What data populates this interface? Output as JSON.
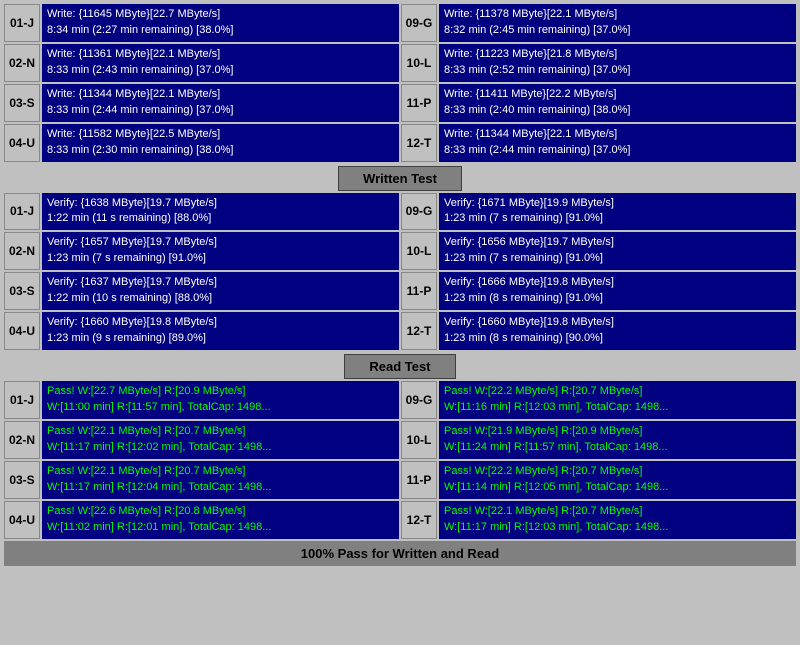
{
  "sections": {
    "write": {
      "label": "Written Test",
      "rows": [
        {
          "left": {
            "id": "01-J",
            "l1": "Write: {11645 MByte}[22.7 MByte/s]",
            "l2": "8:34 min (2:27 min remaining)  [38.0%]"
          },
          "right": {
            "id": "09-G",
            "l1": "Write: {11378 MByte}[22.1 MByte/s]",
            "l2": "8:32 min (2:45 min remaining)  [37.0%]"
          }
        },
        {
          "left": {
            "id": "02-N",
            "l1": "Write: {11361 MByte}[22.1 MByte/s]",
            "l2": "8:33 min (2:43 min remaining)  [37.0%]"
          },
          "right": {
            "id": "10-L",
            "l1": "Write: {11223 MByte}[21.8 MByte/s]",
            "l2": "8:33 min (2:52 min remaining)  [37.0%]"
          }
        },
        {
          "left": {
            "id": "03-S",
            "l1": "Write: {11344 MByte}[22.1 MByte/s]",
            "l2": "8:33 min (2:44 min remaining)  [37.0%]"
          },
          "right": {
            "id": "11-P",
            "l1": "Write: {11411 MByte}[22.2 MByte/s]",
            "l2": "8:33 min (2:40 min remaining)  [38.0%]"
          }
        },
        {
          "left": {
            "id": "04-U",
            "l1": "Write: {11582 MByte}[22.5 MByte/s]",
            "l2": "8:33 min (2:30 min remaining)  [38.0%]"
          },
          "right": {
            "id": "12-T",
            "l1": "Write: {11344 MByte}[22.1 MByte/s]",
            "l2": "8:33 min (2:44 min remaining)  [37.0%]"
          }
        }
      ]
    },
    "verify": {
      "label": "Written Test",
      "rows": [
        {
          "left": {
            "id": "01-J",
            "l1": "Verify: {1638 MByte}[19.7 MByte/s]",
            "l2": "1:22 min (11 s remaining)   [88.0%]"
          },
          "right": {
            "id": "09-G",
            "l1": "Verify: {1671 MByte}[19.9 MByte/s]",
            "l2": "1:23 min (7 s remaining)   [91.0%]"
          }
        },
        {
          "left": {
            "id": "02-N",
            "l1": "Verify: {1657 MByte}[19.7 MByte/s]",
            "l2": "1:23 min (7 s remaining)   [91.0%]"
          },
          "right": {
            "id": "10-L",
            "l1": "Verify: {1656 MByte}[19.7 MByte/s]",
            "l2": "1:23 min (7 s remaining)   [91.0%]"
          }
        },
        {
          "left": {
            "id": "03-S",
            "l1": "Verify: {1637 MByte}[19.7 MByte/s]",
            "l2": "1:22 min (10 s remaining)   [88.0%]"
          },
          "right": {
            "id": "11-P",
            "l1": "Verify: {1666 MByte}[19.8 MByte/s]",
            "l2": "1:23 min (8 s remaining)   [91.0%]"
          }
        },
        {
          "left": {
            "id": "04-U",
            "l1": "Verify: {1660 MByte}[19.8 MByte/s]",
            "l2": "1:23 min (9 s remaining)   [89.0%]"
          },
          "right": {
            "id": "12-T",
            "l1": "Verify: {1660 MByte}[19.8 MByte/s]",
            "l2": "1:23 min (8 s remaining)   [90.0%]"
          }
        }
      ]
    },
    "read": {
      "label": "Read Test",
      "rows": [
        {
          "left": {
            "id": "01-J",
            "l1": "Pass! W:[22.7 MByte/s] R:[20.9 MByte/s]",
            "l2": "W:[11:00 min] R:[11:57 min], TotalCap: 1498..."
          },
          "right": {
            "id": "09-G",
            "l1": "Pass! W:[22.2 MByte/s] R:[20.7 MByte/s]",
            "l2": "W:[11:16 min] R:[12:03 min], TotalCap: 1498..."
          }
        },
        {
          "left": {
            "id": "02-N",
            "l1": "Pass! W:[22.1 MByte/s] R:[20.7 MByte/s]",
            "l2": "W:[11:17 min] R:[12:02 min], TotalCap: 1498..."
          },
          "right": {
            "id": "10-L",
            "l1": "Pass! W:[21.9 MByte/s] R:[20.9 MByte/s]",
            "l2": "W:[11:24 min] R:[11:57 min], TotalCap: 1498..."
          }
        },
        {
          "left": {
            "id": "03-S",
            "l1": "Pass! W:[22.1 MByte/s] R:[20.7 MByte/s]",
            "l2": "W:[11:17 min] R:[12:04 min], TotalCap: 1498..."
          },
          "right": {
            "id": "11-P",
            "l1": "Pass! W:[22.2 MByte/s] R:[20.7 MByte/s]",
            "l2": "W:[11:14 min] R:[12:05 min], TotalCap: 1498..."
          }
        },
        {
          "left": {
            "id": "04-U",
            "l1": "Pass! W:[22.6 MByte/s] R:[20.8 MByte/s]",
            "l2": "W:[11:02 min] R:[12:01 min], TotalCap: 1498..."
          },
          "right": {
            "id": "12-T",
            "l1": "Pass! W:[22.1 MByte/s] R:[20.7 MByte/s]",
            "l2": "W:[11:17 min] R:[12:03 min], TotalCap: 1498..."
          }
        }
      ]
    }
  },
  "headers": {
    "written": "Written Test",
    "read": "Read Test"
  },
  "footer": "100% Pass for Written and Read"
}
